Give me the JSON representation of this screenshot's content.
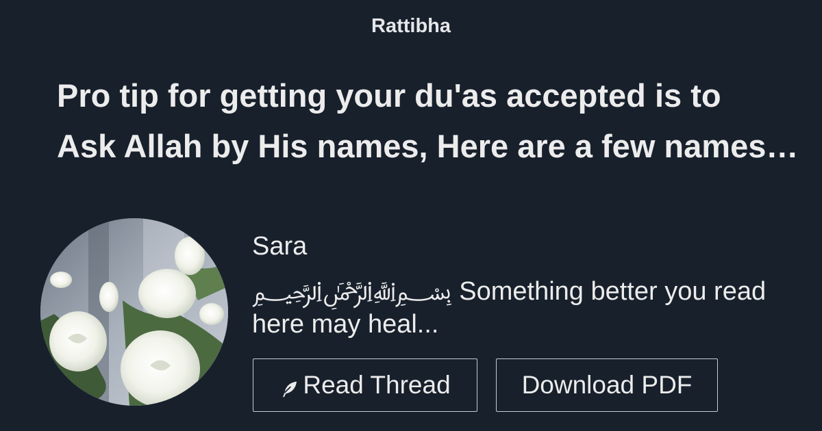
{
  "brand": "Rattibha",
  "thread": {
    "title_line1": "Pro tip for getting your du'as accepted is to",
    "title_line2": "Ask Allah by His names, Here are a few names of Allah and when to call upon them"
  },
  "author": {
    "name": "Sara",
    "avatar_icon": "white-roses-avatar",
    "bio": "﷽ Something better you read here may heal..."
  },
  "actions": {
    "read_label": "Read Thread",
    "read_icon": "feather-icon",
    "pdf_label": "Download PDF"
  },
  "colors": {
    "background": "#18202c",
    "text": "#ececec",
    "button_border": "#c8cdd4"
  }
}
